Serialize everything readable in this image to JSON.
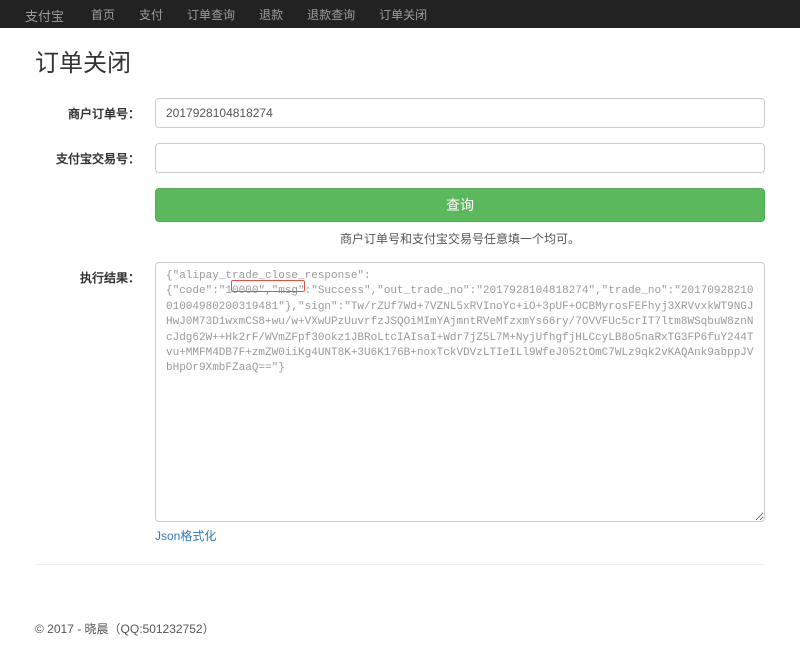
{
  "navbar": {
    "brand": "支付宝",
    "items": [
      {
        "label": "首页"
      },
      {
        "label": "支付"
      },
      {
        "label": "订单查询"
      },
      {
        "label": "退款"
      },
      {
        "label": "退款查询"
      },
      {
        "label": "订单关闭"
      }
    ]
  },
  "page": {
    "title": "订单关闭"
  },
  "form": {
    "merchant_order_label": "商户订单号：",
    "merchant_order_value": "2017928104818274",
    "alipay_trade_label": "支付宝交易号：",
    "alipay_trade_value": "",
    "query_button": "查询",
    "hint": "商户订单号和支付宝交易号任意填一个均可。",
    "result_label": "执行结果：",
    "result_value": "{\"alipay_trade_close_response\":{\"code\":\"10000\",\"msg\":\"Success\",\"out_trade_no\":\"2017928104818274\",\"trade_no\":\"2017092821001004980200319481\"},\"sign\":\"Tw/rZUf7Wd+7VZNL5xRVInoYc+iO+3pUF+OCBMyrosFEFhyj3XRVvxkWT9NGJHwJ0M73D1wxmCS8+wu/w+VXwUPzUuvrfzJSQOiMImYAjmntRVeMfzxmYs66ry/7OVVFUc5crIT7ltm8WSqbuW8znNcJdg62W++Hk2rF/WVmZFpf30okz1JBRoLtcIAIsaI+Wdr7jZ5L7M+NyjUfhgfjHLCcyLB8o5naRxTG3FP6fuY244Tvu+MMFM4DB7F+zmZW0iiKg4UNT8K+3U6K176B+noxTckVDVzLTIeILl9WfeJ052tOmC7WLz9qk2vKAQAnk9abppJVbHpOr9XmbFZaaQ==\"}",
    "json_format_link": "Json格式化"
  },
  "footer": {
    "text": "© 2017 - 晓晨（QQ:501232752）"
  }
}
